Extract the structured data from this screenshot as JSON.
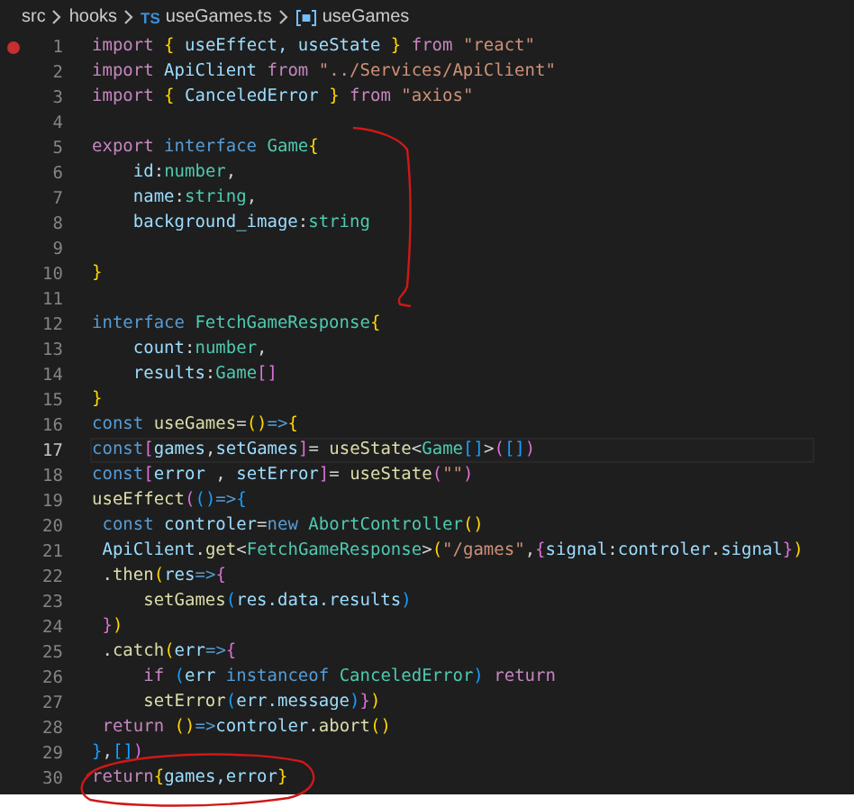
{
  "breadcrumbs": [
    {
      "kind": "folder",
      "text": "src"
    },
    {
      "kind": "folder",
      "text": "hooks"
    },
    {
      "kind": "file",
      "badge": "TS",
      "text": "useGames.ts"
    },
    {
      "kind": "symbol",
      "text": "useGames"
    }
  ],
  "lines": [
    {
      "number": "1",
      "breakpoint": true,
      "current": false,
      "tokens": [
        {
          "kind": "kw",
          "text": "import "
        },
        {
          "kind": "b1",
          "text": "{"
        },
        {
          "kind": "var",
          "text": " useEffect, useState "
        },
        {
          "kind": "b1",
          "text": "}"
        },
        {
          "kind": "kw",
          "text": " from "
        },
        {
          "kind": "str",
          "text": "\"react\""
        }
      ]
    },
    {
      "number": "2",
      "breakpoint": false,
      "current": false,
      "tokens": [
        {
          "kind": "kw",
          "text": "import "
        },
        {
          "kind": "var",
          "text": "ApiClient "
        },
        {
          "kind": "kw",
          "text": "from "
        },
        {
          "kind": "str",
          "text": "\"../Services/ApiClient\""
        }
      ]
    },
    {
      "number": "3",
      "breakpoint": false,
      "current": false,
      "tokens": [
        {
          "kind": "kw",
          "text": "import "
        },
        {
          "kind": "b1",
          "text": "{"
        },
        {
          "kind": "var",
          "text": " CanceledError "
        },
        {
          "kind": "b1",
          "text": "}"
        },
        {
          "kind": "kw",
          "text": " from "
        },
        {
          "kind": "str",
          "text": "\"axios\""
        }
      ]
    },
    {
      "number": "4",
      "breakpoint": false,
      "current": false
    },
    {
      "number": "5",
      "breakpoint": false,
      "current": false,
      "tokens": [
        {
          "kind": "kw",
          "text": "export "
        },
        {
          "kind": "storage",
          "text": "interface "
        },
        {
          "kind": "type",
          "text": "Game"
        },
        {
          "kind": "b1",
          "text": "{"
        }
      ]
    },
    {
      "number": "6",
      "breakpoint": false,
      "current": false,
      "tokens": [
        {
          "kind": "var",
          "text": "    id"
        },
        {
          "kind": "plain",
          "text": ":"
        },
        {
          "kind": "type",
          "text": "number"
        },
        {
          "kind": "plain",
          "text": ","
        }
      ]
    },
    {
      "number": "7",
      "breakpoint": false,
      "current": false,
      "tokens": [
        {
          "kind": "var",
          "text": "    name"
        },
        {
          "kind": "plain",
          "text": ":"
        },
        {
          "kind": "type",
          "text": "string"
        },
        {
          "kind": "plain",
          "text": ","
        }
      ]
    },
    {
      "number": "8",
      "breakpoint": false,
      "current": false,
      "tokens": [
        {
          "kind": "var",
          "text": "    background_image"
        },
        {
          "kind": "plain",
          "text": ":"
        },
        {
          "kind": "type",
          "text": "string"
        }
      ]
    },
    {
      "number": "9",
      "breakpoint": false,
      "current": false
    },
    {
      "number": "10",
      "breakpoint": false,
      "current": false,
      "tokens": [
        {
          "kind": "b1",
          "text": "}"
        }
      ]
    },
    {
      "number": "11",
      "breakpoint": false,
      "current": false
    },
    {
      "number": "12",
      "breakpoint": false,
      "current": false,
      "tokens": [
        {
          "kind": "storage",
          "text": "interface "
        },
        {
          "kind": "type",
          "text": "FetchGameResponse"
        },
        {
          "kind": "b1",
          "text": "{"
        }
      ]
    },
    {
      "number": "13",
      "breakpoint": false,
      "current": false,
      "tokens": [
        {
          "kind": "var",
          "text": "    count"
        },
        {
          "kind": "plain",
          "text": ":"
        },
        {
          "kind": "type",
          "text": "number"
        },
        {
          "kind": "plain",
          "text": ","
        }
      ]
    },
    {
      "number": "14",
      "breakpoint": false,
      "current": false,
      "tokens": [
        {
          "kind": "var",
          "text": "    results"
        },
        {
          "kind": "plain",
          "text": ":"
        },
        {
          "kind": "type",
          "text": "Game"
        },
        {
          "kind": "b2",
          "text": "[]"
        }
      ]
    },
    {
      "number": "15",
      "breakpoint": false,
      "current": false,
      "tokens": [
        {
          "kind": "b1",
          "text": "}"
        }
      ]
    },
    {
      "number": "16",
      "breakpoint": false,
      "current": false,
      "tokens": [
        {
          "kind": "storage",
          "text": "const "
        },
        {
          "kind": "fn",
          "text": "useGames"
        },
        {
          "kind": "plain",
          "text": "="
        },
        {
          "kind": "b1",
          "text": "()"
        },
        {
          "kind": "storage",
          "text": "=>"
        },
        {
          "kind": "b1",
          "text": "{"
        }
      ]
    },
    {
      "number": "17",
      "breakpoint": false,
      "current": true,
      "tokens": [
        {
          "kind": "storage",
          "text": "const"
        },
        {
          "kind": "b2",
          "text": "["
        },
        {
          "kind": "var",
          "text": "games"
        },
        {
          "kind": "plain",
          "text": ","
        },
        {
          "kind": "var",
          "text": "setGames"
        },
        {
          "kind": "b2",
          "text": "]"
        },
        {
          "kind": "plain",
          "text": "="
        },
        {
          "kind": "fn",
          "text": " useState"
        },
        {
          "kind": "plain",
          "text": "<"
        },
        {
          "kind": "type",
          "text": "Game"
        },
        {
          "kind": "b3",
          "text": "[]"
        },
        {
          "kind": "plain",
          "text": ">"
        },
        {
          "kind": "b2",
          "text": "("
        },
        {
          "kind": "b3",
          "text": "[]"
        },
        {
          "kind": "b2",
          "text": ")"
        }
      ]
    },
    {
      "number": "18",
      "breakpoint": false,
      "current": false,
      "tokens": [
        {
          "kind": "storage",
          "text": "const"
        },
        {
          "kind": "b2",
          "text": "["
        },
        {
          "kind": "var",
          "text": "error "
        },
        {
          "kind": "plain",
          "text": ","
        },
        {
          "kind": "var",
          "text": " setError"
        },
        {
          "kind": "b2",
          "text": "]"
        },
        {
          "kind": "plain",
          "text": "="
        },
        {
          "kind": "fn",
          "text": " useState"
        },
        {
          "kind": "b2",
          "text": "("
        },
        {
          "kind": "str",
          "text": "\"\""
        },
        {
          "kind": "b2",
          "text": ")"
        }
      ]
    },
    {
      "number": "19",
      "breakpoint": false,
      "current": false,
      "tokens": [
        {
          "kind": "fn",
          "text": "useEffect"
        },
        {
          "kind": "b2",
          "text": "("
        },
        {
          "kind": "b3",
          "text": "()"
        },
        {
          "kind": "storage",
          "text": "=>"
        },
        {
          "kind": "b3",
          "text": "{"
        }
      ]
    },
    {
      "number": "20",
      "breakpoint": false,
      "current": false,
      "tokens": [
        {
          "kind": "storage",
          "text": " const "
        },
        {
          "kind": "var",
          "text": "controler"
        },
        {
          "kind": "plain",
          "text": "="
        },
        {
          "kind": "storage",
          "text": "new "
        },
        {
          "kind": "type",
          "text": "AbortController"
        },
        {
          "kind": "b1",
          "text": "()"
        }
      ]
    },
    {
      "number": "21",
      "breakpoint": false,
      "current": false,
      "tokens": [
        {
          "kind": "var",
          "text": " ApiClient"
        },
        {
          "kind": "plain",
          "text": "."
        },
        {
          "kind": "fn",
          "text": "get"
        },
        {
          "kind": "plain",
          "text": "<"
        },
        {
          "kind": "type",
          "text": "FetchGameResponse"
        },
        {
          "kind": "plain",
          "text": ">"
        },
        {
          "kind": "b1",
          "text": "("
        },
        {
          "kind": "str",
          "text": "\"/games\""
        },
        {
          "kind": "plain",
          "text": ","
        },
        {
          "kind": "b2",
          "text": "{"
        },
        {
          "kind": "var",
          "text": "signal"
        },
        {
          "kind": "plain",
          "text": ":"
        },
        {
          "kind": "var",
          "text": "controler"
        },
        {
          "kind": "plain",
          "text": "."
        },
        {
          "kind": "var",
          "text": "signal"
        },
        {
          "kind": "b2",
          "text": "}"
        },
        {
          "kind": "b1",
          "text": ")"
        }
      ]
    },
    {
      "number": "22",
      "breakpoint": false,
      "current": false,
      "tokens": [
        {
          "kind": "plain",
          "text": " ."
        },
        {
          "kind": "fn",
          "text": "then"
        },
        {
          "kind": "b1",
          "text": "("
        },
        {
          "kind": "var",
          "text": "res"
        },
        {
          "kind": "storage",
          "text": "=>"
        },
        {
          "kind": "b2",
          "text": "{"
        }
      ]
    },
    {
      "number": "23",
      "breakpoint": false,
      "current": false,
      "tokens": [
        {
          "kind": "fn",
          "text": "     setGames"
        },
        {
          "kind": "b3",
          "text": "("
        },
        {
          "kind": "var",
          "text": "res.data.results"
        },
        {
          "kind": "b3",
          "text": ")"
        }
      ]
    },
    {
      "number": "24",
      "breakpoint": false,
      "current": false,
      "tokens": [
        {
          "kind": "b2",
          "text": " }"
        },
        {
          "kind": "b1",
          "text": ")"
        }
      ]
    },
    {
      "number": "25",
      "breakpoint": false,
      "current": false,
      "tokens": [
        {
          "kind": "plain",
          "text": " ."
        },
        {
          "kind": "fn",
          "text": "catch"
        },
        {
          "kind": "b1",
          "text": "("
        },
        {
          "kind": "var",
          "text": "err"
        },
        {
          "kind": "storage",
          "text": "=>"
        },
        {
          "kind": "b2",
          "text": "{"
        }
      ]
    },
    {
      "number": "26",
      "breakpoint": false,
      "current": false,
      "tokens": [
        {
          "kind": "kw",
          "text": "     if "
        },
        {
          "kind": "b3",
          "text": "("
        },
        {
          "kind": "var",
          "text": "err "
        },
        {
          "kind": "storage",
          "text": "instanceof "
        },
        {
          "kind": "type",
          "text": "CanceledError"
        },
        {
          "kind": "b3",
          "text": ")"
        },
        {
          "kind": "kw",
          "text": " return"
        }
      ]
    },
    {
      "number": "27",
      "breakpoint": false,
      "current": false,
      "tokens": [
        {
          "kind": "fn",
          "text": "     setError"
        },
        {
          "kind": "b3",
          "text": "("
        },
        {
          "kind": "var",
          "text": "err.message"
        },
        {
          "kind": "b3",
          "text": ")"
        },
        {
          "kind": "b2",
          "text": "}"
        },
        {
          "kind": "b1",
          "text": ")"
        }
      ]
    },
    {
      "number": "28",
      "breakpoint": false,
      "current": false,
      "tokens": [
        {
          "kind": "kw",
          "text": " return "
        },
        {
          "kind": "b1",
          "text": "()"
        },
        {
          "kind": "storage",
          "text": "=>"
        },
        {
          "kind": "var",
          "text": "controler"
        },
        {
          "kind": "plain",
          "text": "."
        },
        {
          "kind": "fn",
          "text": "abort"
        },
        {
          "kind": "b1",
          "text": "()"
        }
      ]
    },
    {
      "number": "29",
      "breakpoint": false,
      "current": false,
      "tokens": [
        {
          "kind": "b3",
          "text": "}"
        },
        {
          "kind": "plain",
          "text": ","
        },
        {
          "kind": "b3",
          "text": "[]"
        },
        {
          "kind": "b2",
          "text": ")"
        }
      ]
    },
    {
      "number": "30",
      "breakpoint": false,
      "current": false,
      "tokens": [
        {
          "kind": "kw",
          "text": "return"
        },
        {
          "kind": "b1",
          "text": "{"
        },
        {
          "kind": "var",
          "text": "games,error"
        },
        {
          "kind": "b1",
          "text": "}"
        }
      ]
    }
  ]
}
